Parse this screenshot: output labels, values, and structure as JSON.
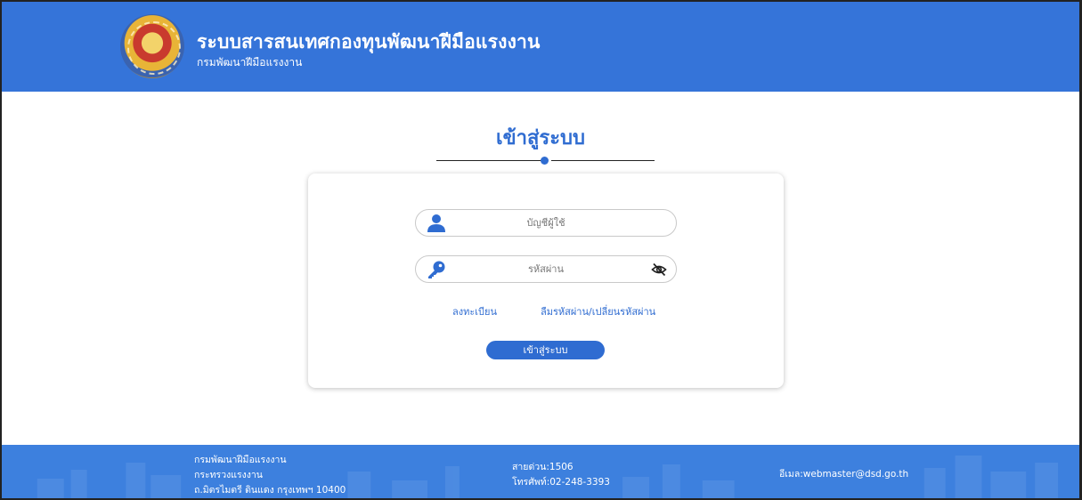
{
  "header": {
    "title": "ระบบสารสนเทศกองทุนพัฒนาฝีมือแรงงาน",
    "subtitle": "กรมพัฒนาฝีมือแรงงาน",
    "logo_icon": "dsd-emblem-icon"
  },
  "login": {
    "heading": "เข้าสู่ระบบ",
    "username_placeholder": "บัญชีผู้ใช้",
    "password_placeholder": "รหัสผ่าน",
    "register_label": "ลงทะเบียน",
    "forgot_label": "ลืมรหัสผ่าน/เปลี่ยนรหัสผ่าน",
    "submit_label": "เข้าสู่ระบบ"
  },
  "footer": {
    "org_line1": "กรมพัฒนาฝีมือแรงงาน",
    "org_line2": "กระทรวงแรงงาน",
    "org_line3": "ถ.มิตรไมตรี ดินแดง กรุงเทพฯ 10400",
    "hotline": "สายด่วน:1506",
    "phone": "โทรศัพท์:02-248-3393",
    "email": "อีเมล:webmaster@dsd.go.th"
  },
  "colors": {
    "brand_blue": "#3574d9",
    "accent_blue": "#2f6cd1",
    "footer_blue": "#3d80de"
  }
}
